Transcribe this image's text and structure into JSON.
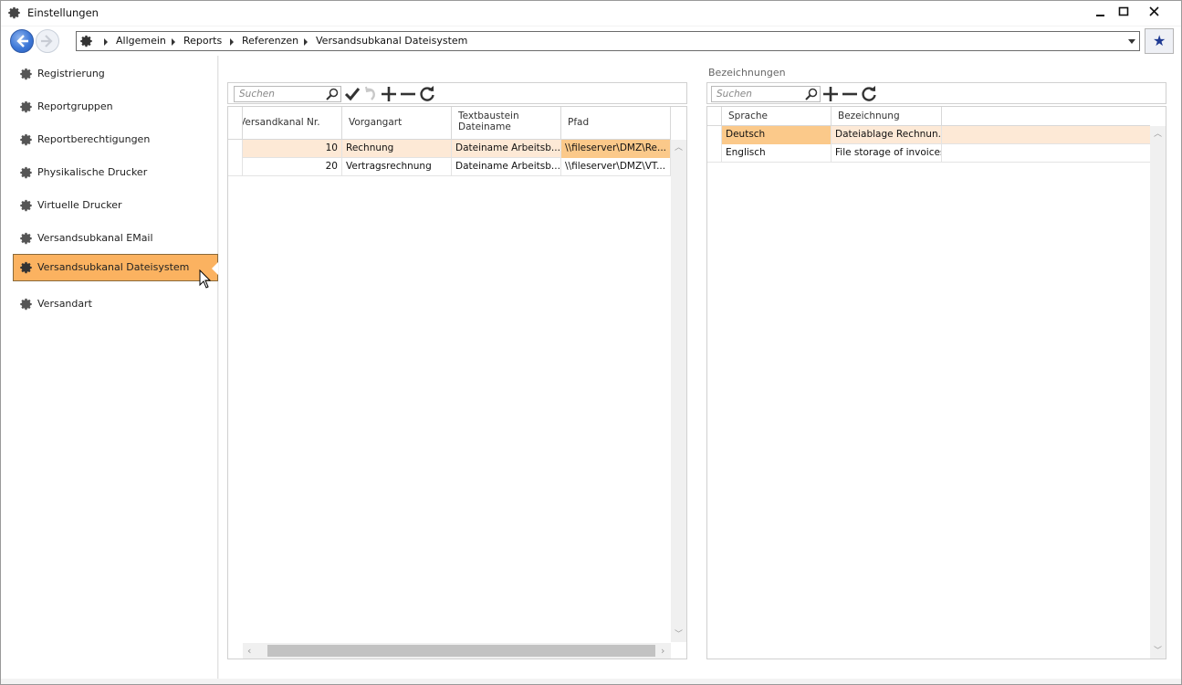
{
  "window": {
    "title": "Einstellungen",
    "icon": "gear-icon"
  },
  "nav": {
    "breadcrumb": [
      "Allgemein",
      "Reports",
      "Referenzen",
      "Versandsubkanal Dateisystem"
    ],
    "favorite_icon": "star-icon"
  },
  "sidebar": {
    "items": [
      {
        "label": "Registrierung"
      },
      {
        "label": "Reportgruppen"
      },
      {
        "label": "Reportberechtigungen"
      },
      {
        "label": "Physikalische Drucker"
      },
      {
        "label": "Virtuelle Drucker"
      },
      {
        "label": "Versandsubkanal EMail"
      },
      {
        "label": "Versandsubkanal Dateisystem"
      },
      {
        "label": "Versandart"
      }
    ],
    "active_index": 6
  },
  "left_grid": {
    "search_placeholder": "Suchen",
    "columns": [
      "Versandkanal Nr.",
      "Vorgangart",
      "Textbaustein",
      "Dateiname",
      "Pfad"
    ],
    "rows": [
      {
        "nr": "10",
        "vorgangart": "Rechnung",
        "textbaustein": "Dateiname Arbeitsb...",
        "pfad": "\\\\fileserver\\DMZ\\Re..."
      },
      {
        "nr": "20",
        "vorgangart": "Vertragsrechnung",
        "textbaustein": "Dateiname Arbeitsb...",
        "pfad": "\\\\fileserver\\DMZ\\VT..."
      }
    ]
  },
  "right_grid": {
    "section_title": "Bezeichnungen",
    "search_placeholder": "Suchen",
    "columns": [
      "Sprache",
      "Bezeichnung"
    ],
    "rows": [
      {
        "sprache": "Deutsch",
        "bezeichnung": "Dateiablage Rechnun..."
      },
      {
        "sprache": "Englisch",
        "bezeichnung": "File storage of invoices"
      }
    ]
  },
  "colors": {
    "active_item": "#fbb260",
    "selected_row": "#fde9d6",
    "selected_cell": "#fbc98a",
    "nav_accent": "#3d78d8"
  }
}
